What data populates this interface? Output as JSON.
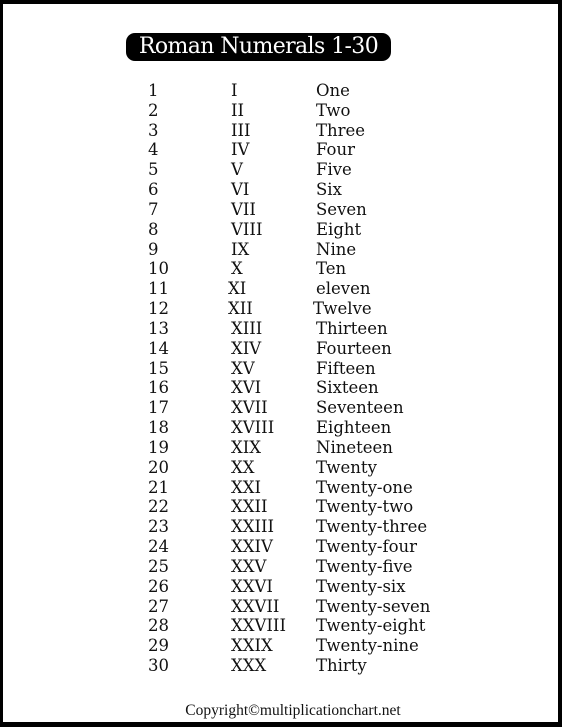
{
  "title": "Roman Numerals 1-30",
  "rows": [
    {
      "number": "1",
      "roman": "I",
      "word": "One"
    },
    {
      "number": "2",
      "roman": "II",
      "word": "Two"
    },
    {
      "number": "3",
      "roman": "III",
      "word": "Three"
    },
    {
      "number": "4",
      "roman": "IV",
      "word": "Four"
    },
    {
      "number": "5",
      "roman": "V",
      "word": "Five"
    },
    {
      "number": "6",
      "roman": "VI",
      "word": "Six"
    },
    {
      "number": "7",
      "roman": "VII",
      "word": "Seven"
    },
    {
      "number": "8",
      "roman": "VIII",
      "word": "Eight"
    },
    {
      "number": "9",
      "roman": "IX",
      "word": "Nine"
    },
    {
      "number": "10",
      "roman": "X",
      "word": "Ten"
    },
    {
      "number": "11",
      "roman": "XI",
      "word": "eleven"
    },
    {
      "number": "12",
      "roman": "XII",
      "word": "Twelve"
    },
    {
      "number": "13",
      "roman": "XIII",
      "word": "Thirteen"
    },
    {
      "number": "14",
      "roman": "XIV",
      "word": "Fourteen"
    },
    {
      "number": "15",
      "roman": "XV",
      "word": "Fifteen"
    },
    {
      "number": "16",
      "roman": "XVI",
      "word": "Sixteen"
    },
    {
      "number": "17",
      "roman": "XVII",
      "word": "Seventeen"
    },
    {
      "number": "18",
      "roman": "XVIII",
      "word": "Eighteen"
    },
    {
      "number": "19",
      "roman": "XIX",
      "word": "Nineteen"
    },
    {
      "number": "20",
      "roman": "XX",
      "word": "Twenty"
    },
    {
      "number": "21",
      "roman": "XXI",
      "word": "Twenty-one"
    },
    {
      "number": "22",
      "roman": "XXII",
      "word": "Twenty-two"
    },
    {
      "number": "23",
      "roman": "XXIII",
      "word": "Twenty-three"
    },
    {
      "number": "24",
      "roman": "XXIV",
      "word": "Twenty-four"
    },
    {
      "number": "25",
      "roman": "XXV",
      "word": "Twenty-five"
    },
    {
      "number": "26",
      "roman": "XXVI",
      "word": "Twenty-six"
    },
    {
      "number": "27",
      "roman": "XXVII",
      "word": "Twenty-seven"
    },
    {
      "number": "28",
      "roman": "XXVIII",
      "word": "Twenty-eight"
    },
    {
      "number": "29",
      "roman": "XXIX",
      "word": "Twenty-nine"
    },
    {
      "number": "30",
      "roman": "XXX",
      "word": "Thirty"
    }
  ],
  "footer": {
    "copyright": "Copyright©multiplicationchart.net"
  }
}
